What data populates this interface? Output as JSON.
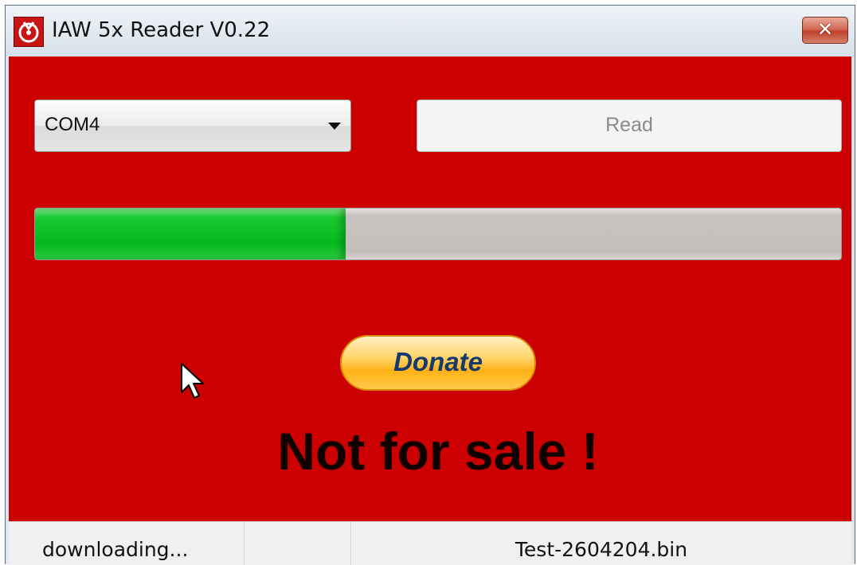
{
  "window": {
    "title": "IAW 5x Reader V0.22",
    "close_label": "✕"
  },
  "port_select": {
    "value": "COM4"
  },
  "read_button": {
    "label": "Read",
    "enabled": false
  },
  "progress": {
    "value": 0.385
  },
  "donate_button": {
    "label": "Donate"
  },
  "notice": "Not for sale !",
  "status": {
    "message": "downloading...",
    "middle": "",
    "filename": "Test-2604204.bin"
  },
  "colors": {
    "background": "#cc0000",
    "progress_fill": "#06b91f",
    "donate": "#ffb116"
  }
}
